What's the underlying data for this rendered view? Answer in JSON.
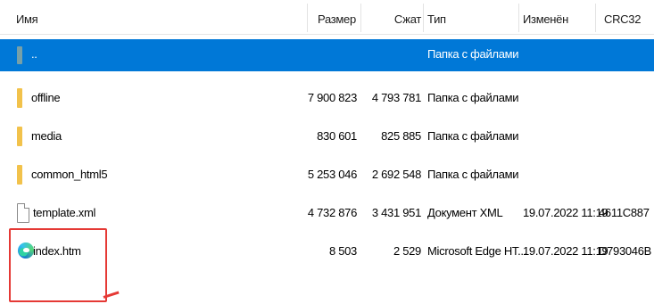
{
  "columns": {
    "name": "Имя",
    "size": "Размер",
    "packed": "Сжат",
    "type": "Тип",
    "modified": "Изменён",
    "crc": "CRC32"
  },
  "rows": [
    {
      "name": "..",
      "icon": "parent-folder-icon",
      "size": "",
      "packed": "",
      "type": "Папка с файлами",
      "modified": "",
      "crc": "",
      "selected": true
    },
    {
      "name": "offline",
      "icon": "folder-icon",
      "size": "7 900 823",
      "packed": "4 793 781",
      "type": "Папка с файлами",
      "modified": "",
      "crc": ""
    },
    {
      "name": "media",
      "icon": "folder-icon",
      "size": "830 601",
      "packed": "825 885",
      "type": "Папка с файлами",
      "modified": "",
      "crc": ""
    },
    {
      "name": "common_html5",
      "icon": "folder-icon",
      "size": "5 253 046",
      "packed": "2 692 548",
      "type": "Папка с файлами",
      "modified": "",
      "crc": ""
    },
    {
      "name": "template.xml",
      "icon": "xml-file-icon",
      "size": "4 732 876",
      "packed": "3 431 951",
      "type": "Документ XML",
      "modified": "19.07.2022 11:19",
      "crc": "4611C887"
    },
    {
      "name": "index.htm",
      "icon": "edge-browser-icon",
      "size": "8 503",
      "packed": "2 529",
      "type": "Microsoft Edge HT...",
      "modified": "19.07.2022 11:19",
      "crc": "D793046B"
    }
  ],
  "colors": {
    "selection": "#0078d7",
    "folder": "#f2c24b",
    "highlight": "#e53935"
  }
}
